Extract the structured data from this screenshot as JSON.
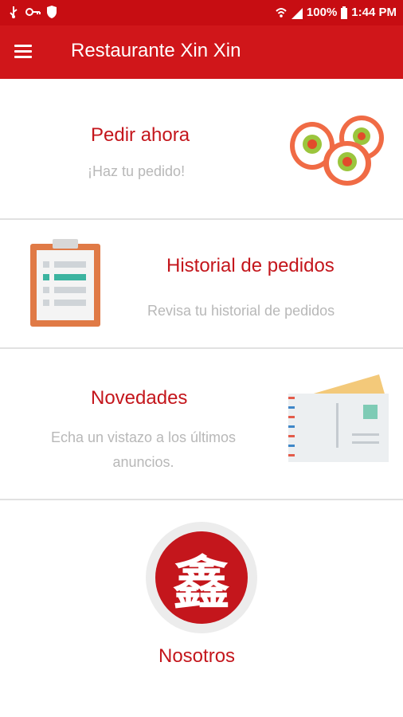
{
  "status_bar": {
    "battery": "100%",
    "time": "1:44 PM",
    "icons": [
      "usb-icon",
      "key-icon",
      "shield-icon",
      "wifi-icon",
      "signal-icon",
      "battery-icon"
    ]
  },
  "app_bar": {
    "title": "Restaurante Xin Xin",
    "menu_icon": "hamburger-menu-icon"
  },
  "sections": {
    "order_now": {
      "title": "Pedir ahora",
      "subtitle": "¡Haz tu pedido!",
      "icon": "sushi-icon"
    },
    "history": {
      "title": "Historial de pedidos",
      "subtitle": "Revisa tu historial de pedidos",
      "icon": "clipboard-icon"
    },
    "news": {
      "title": "Novedades",
      "subtitle": "Echa un vistazo a los últimos anuncios.",
      "icon": "envelope-icon"
    },
    "about": {
      "title": "Nosotros",
      "logo_text": "鑫",
      "icon": "restaurant-logo-icon"
    }
  },
  "colors": {
    "primary": "#d0161a",
    "status_bar": "#c70d12",
    "heading": "#c4161c",
    "subtitle": "#b8b8b8"
  }
}
